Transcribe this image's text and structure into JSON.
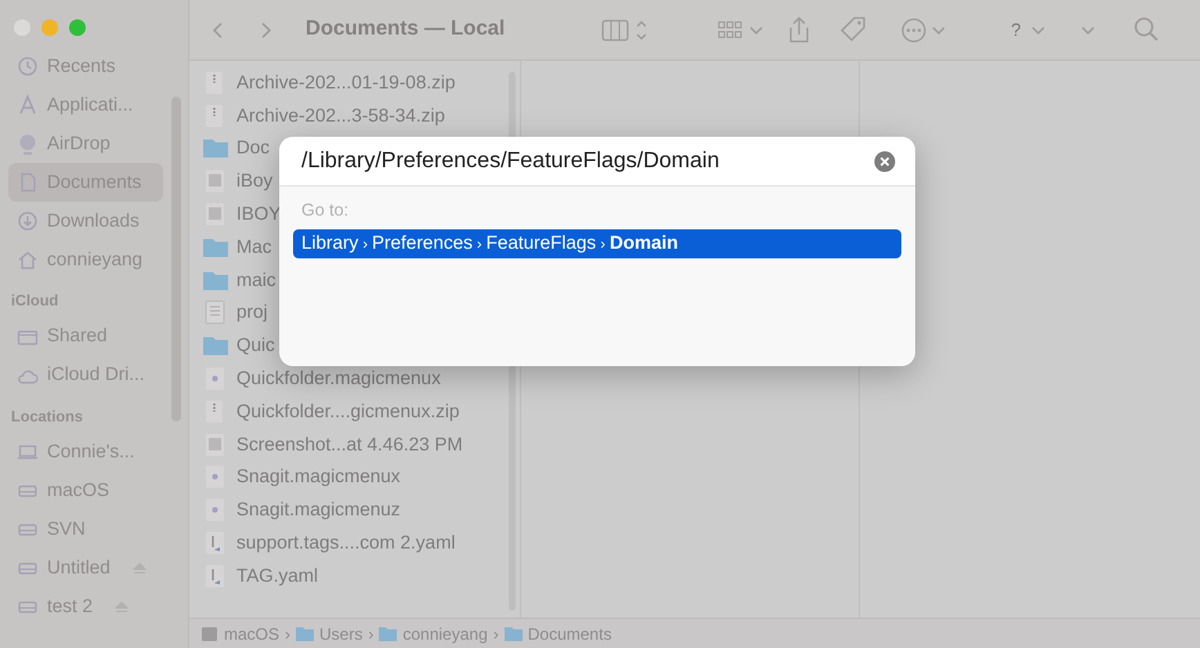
{
  "window": {
    "title": "Documents — Local",
    "traffic_lights": [
      {
        "color": "#dcd9d9"
      },
      {
        "color": "#f0b429"
      },
      {
        "color": "#2fbf3a"
      }
    ]
  },
  "sidebar": {
    "sections": [
      {
        "items": [
          {
            "label": "Recents",
            "selected": false
          },
          {
            "label": "Applicati...",
            "selected": false
          },
          {
            "label": "AirDrop",
            "selected": false
          },
          {
            "label": "Documents",
            "selected": true
          },
          {
            "label": "Downloads",
            "selected": false
          },
          {
            "label": "connieyang",
            "selected": false
          }
        ]
      },
      {
        "header": "iCloud",
        "items": [
          {
            "label": "Shared",
            "selected": false
          },
          {
            "label": "iCloud Dri...",
            "selected": false
          }
        ]
      },
      {
        "header": "Locations",
        "items": [
          {
            "label": "Connie's...",
            "selected": false
          },
          {
            "label": "macOS",
            "selected": false
          },
          {
            "label": "SVN",
            "selected": false
          },
          {
            "label": "Untitled",
            "selected": false,
            "ejectable": true
          },
          {
            "label": "test 2",
            "selected": false,
            "ejectable": true
          }
        ]
      }
    ]
  },
  "toolbar": {
    "help": "?"
  },
  "files": [
    {
      "name": "Archive-202...01-19-08.zip",
      "kind": "zip"
    },
    {
      "name": "Archive-202...3-58-34.zip",
      "kind": "zip"
    },
    {
      "name": "Doc",
      "kind": "folder"
    },
    {
      "name": "iBoy",
      "kind": "image"
    },
    {
      "name": "IBOY",
      "kind": "image"
    },
    {
      "name": "Mac",
      "kind": "folder"
    },
    {
      "name": "maic",
      "kind": "folder"
    },
    {
      "name": "proj",
      "kind": "doc"
    },
    {
      "name": "Quic",
      "kind": "folder"
    },
    {
      "name": "Quickfolder.magicmenux",
      "kind": "plugin"
    },
    {
      "name": "Quickfolder....gicmenux.zip",
      "kind": "zip"
    },
    {
      "name": "Screenshot...at 4.46.23 PM",
      "kind": "image"
    },
    {
      "name": "Snagit.magicmenux",
      "kind": "plugin"
    },
    {
      "name": "Snagit.magicmenuz",
      "kind": "plugin"
    },
    {
      "name": "support.tags....com 2.yaml",
      "kind": "yaml"
    },
    {
      "name": "TAG.yaml",
      "kind": "yaml"
    }
  ],
  "path_bar": {
    "separator": "›",
    "items": [
      {
        "label": "macOS"
      },
      {
        "label": "Users"
      },
      {
        "label": "connieyang"
      },
      {
        "label": "Documents"
      }
    ]
  },
  "go_to_dialog": {
    "value": "/Library/Preferences/FeatureFlags/Domain",
    "label": "Go to:",
    "suggestions": [
      {
        "segments": [
          "Library",
          "Preferences",
          "FeatureFlags",
          "Domain"
        ],
        "separator": "›",
        "selected": true
      }
    ]
  }
}
